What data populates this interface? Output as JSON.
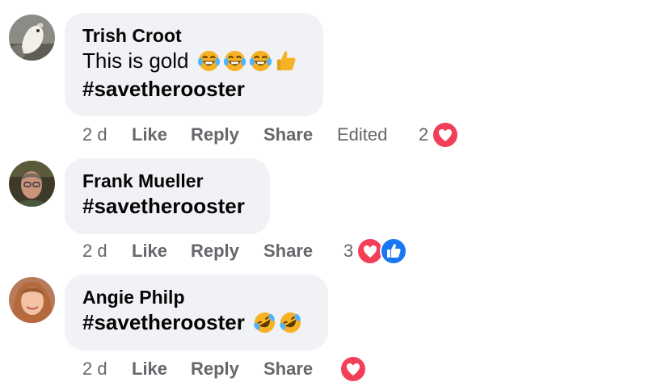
{
  "comments": [
    {
      "author": "Trish Croot",
      "line1": "This is gold",
      "line2": "#savetherooster",
      "time": "2 d",
      "like": "Like",
      "reply": "Reply",
      "share": "Share",
      "edited": "Edited",
      "reaction_count": "2",
      "reactions": [
        "love-icon"
      ]
    },
    {
      "author": "Frank Mueller",
      "line1": "#savetherooster",
      "time": "2 d",
      "like": "Like",
      "reply": "Reply",
      "share": "Share",
      "reaction_count": "3",
      "reactions": [
        "love-icon",
        "like-icon"
      ]
    },
    {
      "author": "Angie Philp",
      "line1": "#savetherooster",
      "time": "2 d",
      "like": "Like",
      "reply": "Reply",
      "share": "Share",
      "reactions": [
        "love-icon"
      ]
    }
  ],
  "colors": {
    "love": "#f33e58",
    "like": "#1877f2",
    "bubble": "#f0f2f5",
    "meta": "#65676b"
  }
}
